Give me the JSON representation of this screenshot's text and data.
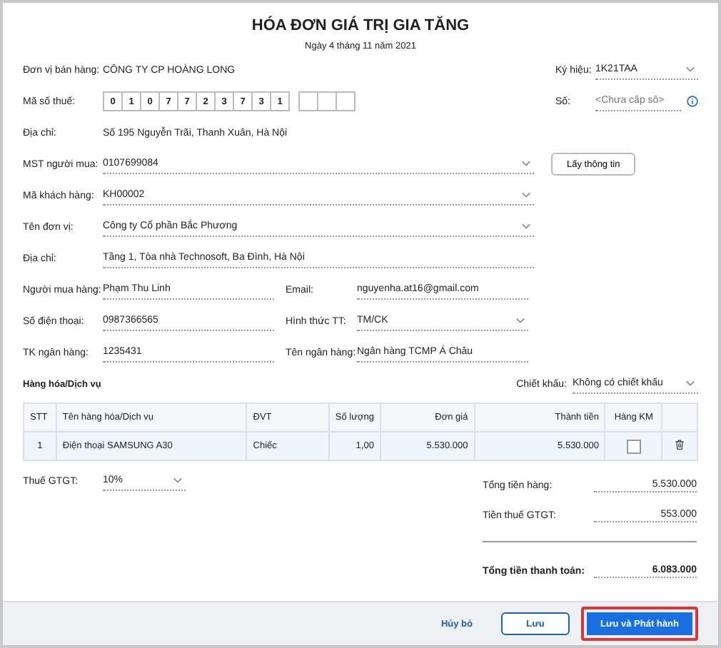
{
  "header": {
    "title": "HÓA ĐƠN GIÁ TRỊ GIA TĂNG",
    "date": "Ngày 4 tháng 11 năm 2021"
  },
  "seller": {
    "name_label": "Đơn vị bán hàng:",
    "name": "CÔNG TY CP HOÀNG LONG",
    "tax_label": "Mã số thuế:",
    "tax_digits": [
      "0",
      "1",
      "0",
      "7",
      "7",
      "2",
      "3",
      "7",
      "3",
      "1"
    ],
    "address_label": "Địa chỉ:",
    "address": "Số 195 Nguyễn Trãi, Thanh Xuân, Hà Nội"
  },
  "symbol": {
    "label": "Ký hiệu:",
    "value": "1K21TAA"
  },
  "number": {
    "label": "Số:",
    "placeholder": "<Chưa cấp số>"
  },
  "buyer_rows": [
    {
      "fields": [
        {
          "label": "MST người mua:",
          "value": "0107699084",
          "kind": "select"
        }
      ],
      "button": "Lấy thông tin"
    },
    {
      "fields": [
        {
          "label": "Mã khách hàng:",
          "value": "KH00002",
          "kind": "select"
        }
      ]
    },
    {
      "fields": [
        {
          "label": "Tên đơn vị:",
          "value": "Công ty Cổ phần Bắc Phương",
          "kind": "select"
        }
      ]
    },
    {
      "fields": [
        {
          "label": "Địa chỉ:",
          "value": "Tầng 1, Tòa nhà Technosoft, Ba Đình, Hà Nội",
          "kind": "text"
        }
      ]
    },
    {
      "fields": [
        {
          "label": "Người mua hàng:",
          "value": "Phạm Thu Linh",
          "kind": "text"
        },
        {
          "label": "Email:",
          "value": "nguyenha.at16@gmail.com",
          "kind": "text"
        }
      ]
    },
    {
      "fields": [
        {
          "label": "Số điện thoại:",
          "value": "0987366565",
          "kind": "text"
        },
        {
          "label": "Hình thức TT:",
          "value": "TM/CK",
          "kind": "select"
        }
      ]
    },
    {
      "fields": [
        {
          "label": "TK ngân hàng:",
          "value": "1235431",
          "kind": "text"
        },
        {
          "label": "Tên ngân hàng:",
          "value": "Ngân hàng TCMP Á Châu",
          "kind": "text"
        }
      ]
    }
  ],
  "goods": {
    "title": "Hàng hóa/Dịch vụ",
    "discount": {
      "label": "Chiết khấu:",
      "value": "Không có chiết khấu"
    }
  },
  "table": {
    "columns": [
      "STT",
      "Tên hàng hóa/Dịch vụ",
      "ĐVT",
      "Số lượng",
      "Đơn giá",
      "Thành tiền",
      "Hàng KM"
    ],
    "rows": [
      {
        "cells": [
          "1",
          "Điện thoại SAMSUNG A30",
          "Chiếc",
          "1,00",
          "5.530.000",
          "5.530.000"
        ],
        "promo": false
      }
    ]
  },
  "tax": {
    "label": "Thuế GTGT:",
    "value": "10%"
  },
  "totals": [
    {
      "label": "Tổng tiền hàng:",
      "value": "5.530.000",
      "kind": "sub"
    },
    {
      "label": "Tiền thuế GTGT:",
      "value": "553.000",
      "kind": "sub"
    },
    {
      "label": "Tổng tiền thanh toán:",
      "value": "6.083.000",
      "kind": "grand"
    }
  ],
  "buttons": [
    {
      "label": "Hủy bỏ",
      "kind": "link",
      "highlighted": false
    },
    {
      "label": "Lưu",
      "kind": "outline",
      "highlighted": false
    },
    {
      "label": "Lưu và Phát hành",
      "kind": "primary",
      "highlighted": true
    }
  ]
}
